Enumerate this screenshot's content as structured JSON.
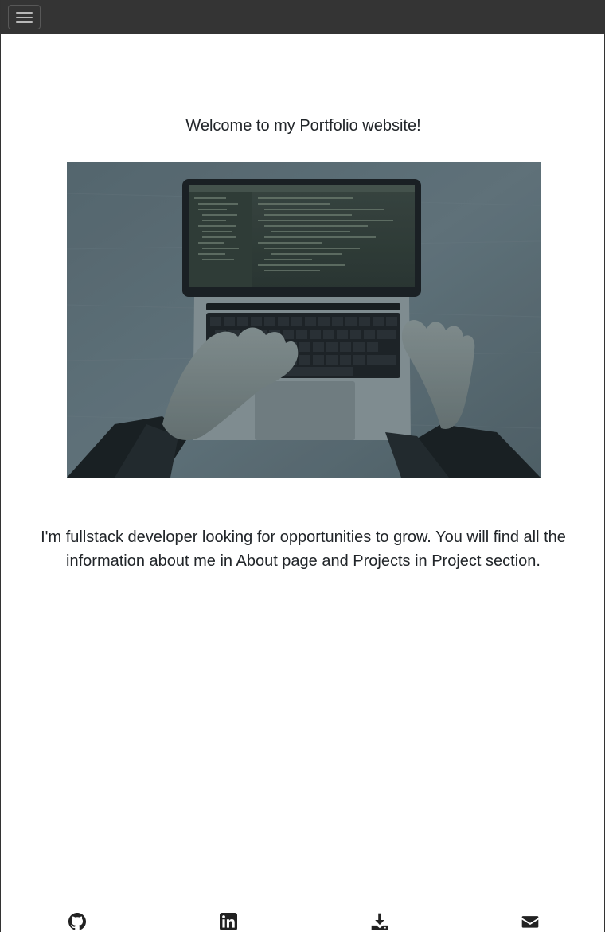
{
  "navbar": {
    "toggle_icon": "hamburger-menu-icon"
  },
  "main": {
    "welcome_text": "Welcome to my Portfolio website!",
    "hero_image": "laptop-typing-photo",
    "intro_text": "I'm fullstack developer looking for opportunities to grow. You will find all the information about me in About page and Projects in Project section."
  },
  "footer": {
    "icons": [
      "github-icon",
      "linkedin-icon",
      "download-icon",
      "envelope-icon"
    ]
  },
  "colors": {
    "navbar_bg": "#343434",
    "text": "#212529",
    "icon": "#222222"
  }
}
